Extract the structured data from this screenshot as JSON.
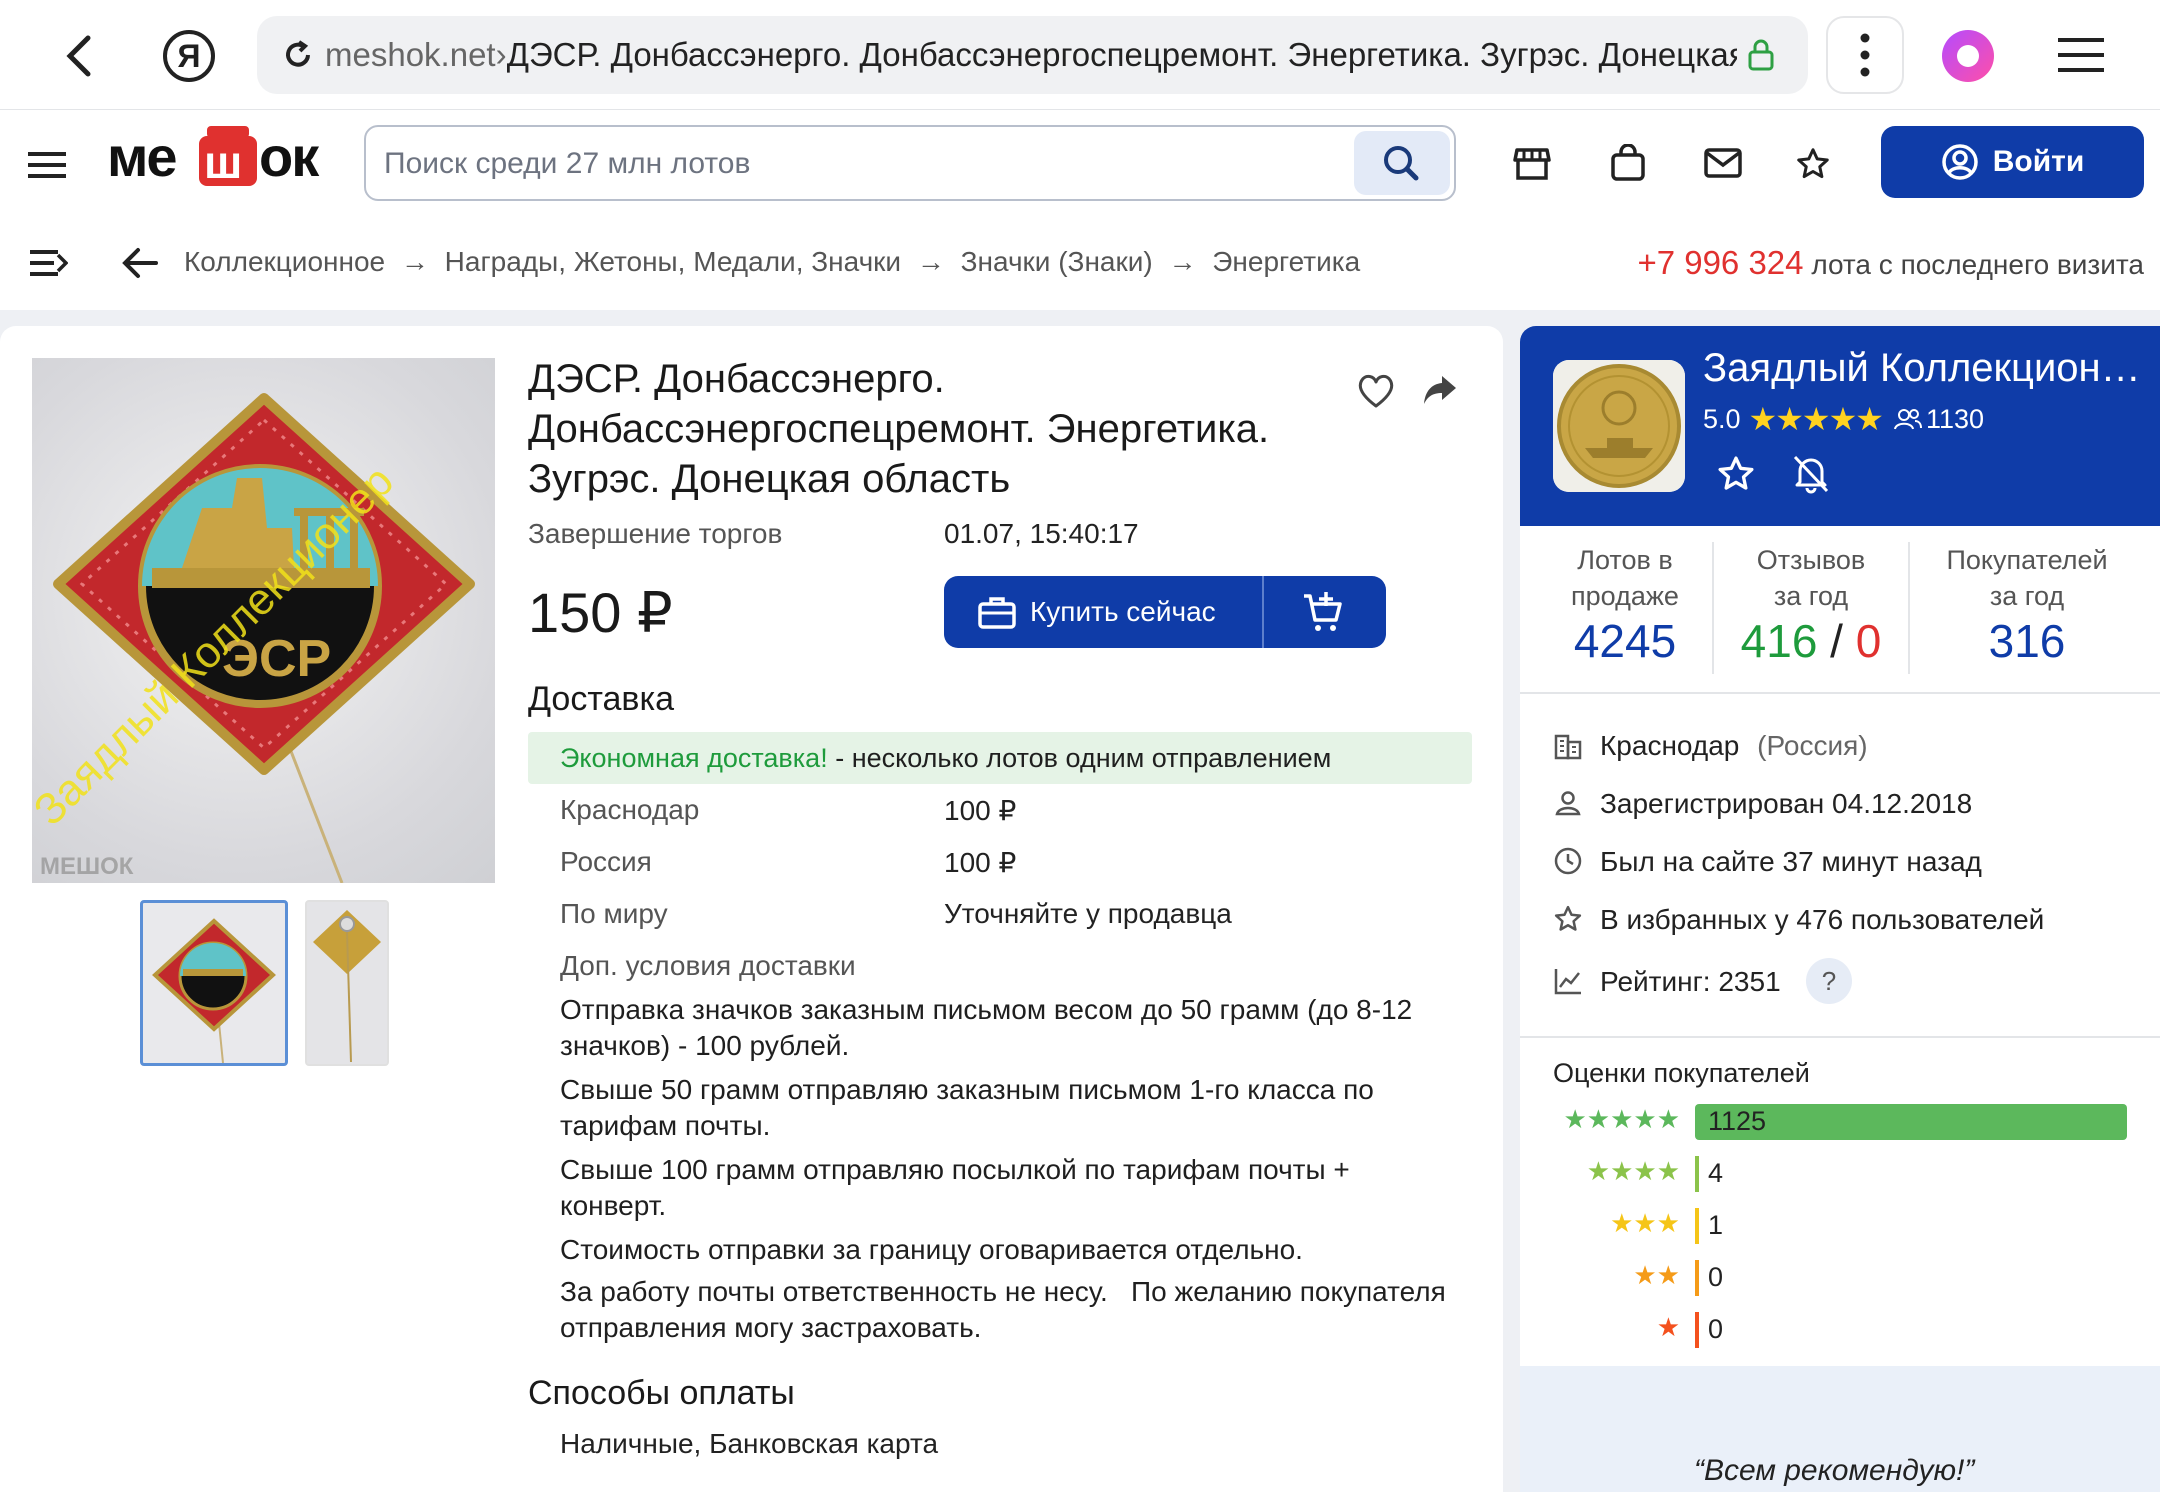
{
  "browser": {
    "url_domain": "meshok.net",
    "url_sep": " › ",
    "url_path": "ДЭСР. Донбассэнерго. Донбассэнергоспецремонт. Энергетика. Зугрэс. Донецкая область"
  },
  "header": {
    "logo": "МЕШОК",
    "search_placeholder": "Поиск среди 27 млн лотов",
    "login_label": "Войти"
  },
  "breadcrumbs": [
    "Коллекционное",
    "Награды, Жетоны, Медали, Значки",
    "Значки (Знаки)",
    "Энергетика"
  ],
  "breadcrumb_sep": "→",
  "visit": {
    "count": "+7 996 324",
    "text": "лота с последнего визита"
  },
  "watermark": {
    "text": "Заядлый Коллекционер",
    "logo": "МЕШОК"
  },
  "lot": {
    "title": "ДЭСР. Донбассэнерго. Донбассэнергоспецремонт. Энергетика. Зугрэс. Донецкая область",
    "end_label": "Завершение торгов",
    "end_value": "01.07, 15:40:17",
    "price": "150 ₽",
    "buy_label": "Купить сейчас"
  },
  "delivery": {
    "heading": "Доставка",
    "econ_highlight": "Экономная доставка!",
    "econ_rest": " - несколько лотов одним отправлением",
    "rows": [
      {
        "label": "Краснодар",
        "value": "100 ₽"
      },
      {
        "label": "Россия",
        "value": "100 ₽"
      },
      {
        "label": "По миру",
        "value": "Уточняйте у продавца"
      }
    ],
    "extra_heading": "Доп. условия доставки",
    "paragraphs": [
      "Отправка значков заказным письмом весом до 50 грамм (до 8-12 значков) - 100 рублей.",
      "Свыше 50 грамм отправляю заказным письмом 1-го класса по тарифам почты.",
      "Свыше 100 грамм отправляю посылкой по тарифам почты + конверт.",
      "Стоимость отправки за границу оговаривается отдельно.",
      "За работу почты ответственность не несу.   По желанию покупателя отправления могу застраховать."
    ]
  },
  "payment": {
    "heading": "Способы оплаты",
    "value": "Наличные, Банковская карта"
  },
  "seller": {
    "name": "Заядлый Коллекционер",
    "rating": "5.0",
    "followers": "1130",
    "stats": [
      {
        "label1": "Лотов в",
        "label2": "продаже",
        "value": "4245"
      },
      {
        "label1": "Отзывов",
        "label2": "за год",
        "value_pos": "416",
        "value_sep": " / ",
        "value_neg": "0"
      },
      {
        "label1": "Покупателей",
        "label2": "за год",
        "value": "316"
      }
    ],
    "city": "Краснодар",
    "country": "(Россия)",
    "registered_label": "Зарегистрирован ",
    "registered_value": "04.12.2018",
    "seen_label": "Был на сайте ",
    "seen_value": "37 минут назад",
    "fav_label": "В избранных у ",
    "fav_value": "476 пользователей",
    "rating_label": "Рейтинг: ",
    "rating_value": "2351",
    "rating_help": "?",
    "ratings_heading": "Оценки покупателей",
    "ratings": [
      {
        "stars": "★★★★★",
        "count": "1125",
        "fraction": 1.0,
        "color": "#5cb85c"
      },
      {
        "stars": "★★★★",
        "count": "4",
        "fraction": 0.0036,
        "color": "#8bc34a"
      },
      {
        "stars": "★★★",
        "count": "1",
        "fraction": 0.0009,
        "color": "#f5c518"
      },
      {
        "stars": "★★",
        "count": "0",
        "fraction": 0,
        "color": "#f59b18"
      },
      {
        "stars": "★",
        "count": "0",
        "fraction": 0,
        "color": "#f4511e"
      }
    ],
    "quote": "“Всем рекомендую!”"
  },
  "colors": {
    "accent": "#0f3ca8",
    "success": "#1e9b3c",
    "danger": "#e0312f"
  }
}
